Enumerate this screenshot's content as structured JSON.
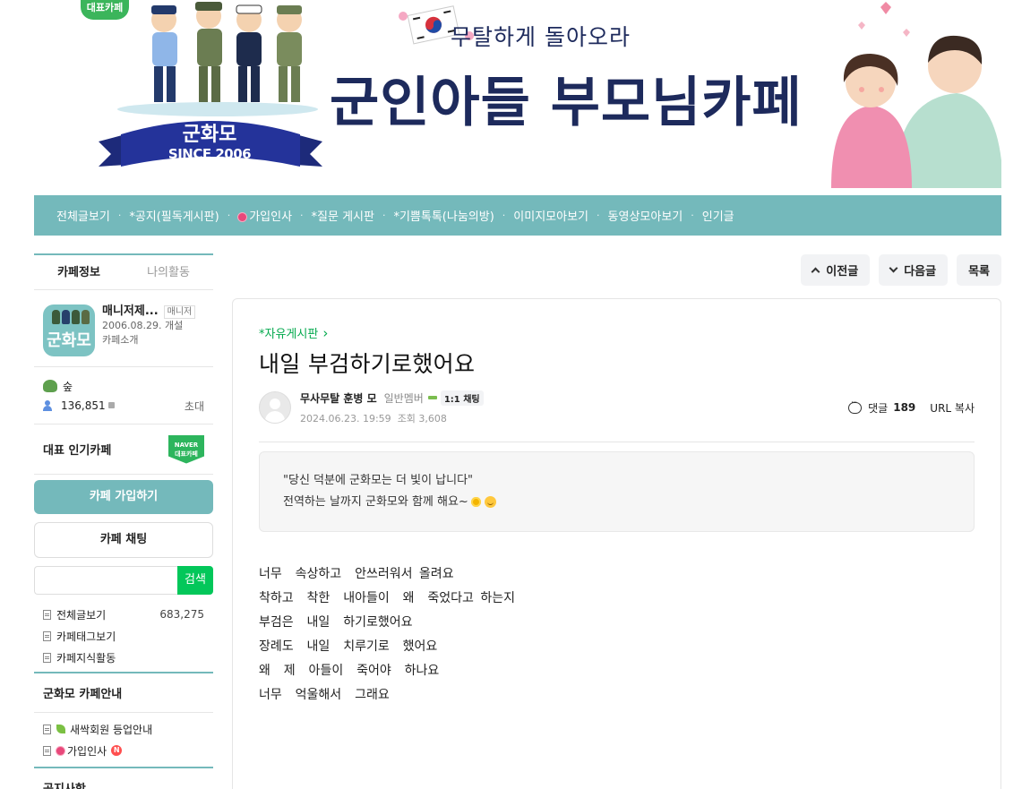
{
  "banner": {
    "badge_title": "군화모",
    "badge_since": "SINCE 2006",
    "corner_badge": "대표카페",
    "subtitle": "무탈하게 돌아오라",
    "title": "군인아들 부모님카페"
  },
  "nav": {
    "items": [
      "전체글보기",
      "*공지(필독게시판)",
      "가입인사",
      "*질문 게시판",
      "*기쁨톡톡(나눔의방)",
      "이미지모아보기",
      "동영상모아보기",
      "인기글"
    ],
    "separator": "·"
  },
  "sidebar": {
    "tabs": [
      "카페정보",
      "나의활동"
    ],
    "manager_name": "매니저제...",
    "manager_tag": "매니저",
    "opened": "2006.08.29. 개설",
    "cafe_intro": "카페소개",
    "logo_text": "군화모",
    "level": "숲",
    "members": "136,851",
    "invite": "초대",
    "representative": "대표 인기카페",
    "naver_badge_line1": "NAVER",
    "naver_badge_line2": "대표카페",
    "join_button": "카페 가입하기",
    "chat_button": "카페 채팅",
    "search_placeholder": "",
    "search_button": "검색",
    "links": [
      {
        "label": "전체글보기",
        "count": "683,275"
      },
      {
        "label": "카페태그보기",
        "count": ""
      },
      {
        "label": "카페지식활동",
        "count": ""
      }
    ],
    "guide_title": "군화모 카페안내",
    "guide_links": [
      "새싹회원 등업안내",
      "가입인사"
    ],
    "new_badge": "N",
    "notice_title": "공지사항"
  },
  "toolbar": {
    "prev": "이전글",
    "next": "다음글",
    "list": "목록"
  },
  "article": {
    "board": "*자유게시판",
    "title": "내일 부검하기로했어요",
    "author": "무사무탈 훈병 모",
    "author_level": "일반멤버",
    "chat_chip": "1:1 채팅",
    "date": "2024.06.23. 19:59",
    "views": "조회 3,608",
    "comment_label": "댓글",
    "comment_count": "189",
    "url_copy": "URL 복사",
    "quote_line1": "\"당신 덕분에 군화모는 더 빛이 납니다\"",
    "quote_line2": "전역하는 날까지 군화모와 함께 해요~",
    "body_lines": [
      "너무  속상하고  안쓰러워서 올려요",
      "착하고  착한  내아들이  왜  죽었다고 하는지",
      "부검은  내일  하기로했어요",
      "장례도  내일  치루기로  했어요",
      "왜  제  아들이  죽어야  하나요",
      "너무  억울해서  그래요"
    ]
  },
  "colors": {
    "accent": "#74b9bb",
    "naver_green": "#03c75a",
    "banner_navy": "#1d2a5c"
  }
}
